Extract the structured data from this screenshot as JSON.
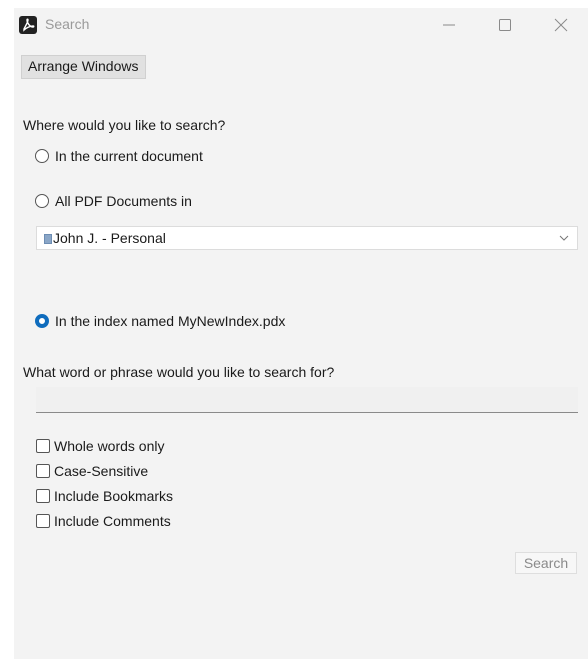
{
  "window": {
    "title": "Search",
    "icon": "pdf-app-icon",
    "controls": {
      "minimize_icon": "minimize-icon",
      "maximize_icon": "maximize-icon",
      "close_icon": "close-icon"
    }
  },
  "toolbar": {
    "arrange_label": "Arrange Windows"
  },
  "location": {
    "heading": "Where would you like to search?",
    "options": [
      {
        "label": "In the current document",
        "selected": false
      },
      {
        "label": "All PDF Documents in",
        "selected": false
      },
      {
        "label": "In the index named MyNewIndex.pdx",
        "selected": true
      }
    ],
    "folder_select": {
      "value": "John J. - Personal",
      "icon": "document-icon"
    }
  },
  "query": {
    "heading": "What word or phrase would you like to search for?",
    "value": "",
    "placeholder": ""
  },
  "options": [
    {
      "label": "Whole words only",
      "checked": false
    },
    {
      "label": "Case-Sensitive",
      "checked": false
    },
    {
      "label": "Include Bookmarks",
      "checked": false
    },
    {
      "label": "Include Comments",
      "checked": false
    }
  ],
  "actions": {
    "search_label": "Search",
    "search_enabled": false
  },
  "colors": {
    "accent": "#0f6cbd",
    "window_bg": "#f3f3f3"
  }
}
